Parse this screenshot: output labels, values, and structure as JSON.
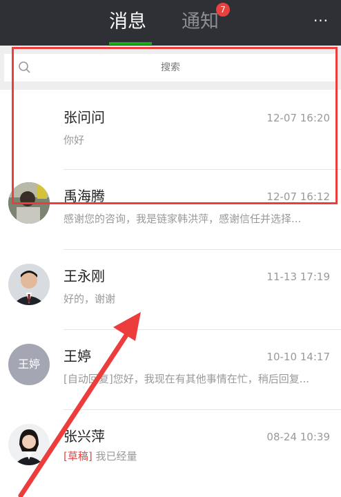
{
  "header": {
    "tabs": [
      {
        "label": "消息",
        "active": true
      },
      {
        "label": "通知",
        "active": false,
        "badge": "7"
      }
    ],
    "more_label": "···"
  },
  "search": {
    "placeholder": "搜索"
  },
  "conversations": [
    {
      "name": "张问问",
      "time": "12-07 16:20",
      "preview": "你好",
      "draft_tag": "",
      "avatar": "none"
    },
    {
      "name": "禹海腾",
      "time": "12-07 16:12",
      "preview": "感谢您的咨询，我是链家韩洪萍，感谢信任并选择...",
      "draft_tag": "",
      "avatar": "photo"
    },
    {
      "name": "王永刚",
      "time": "11-13 17:19",
      "preview": "好的，谢谢",
      "draft_tag": "",
      "avatar": "photo"
    },
    {
      "name": "王婷",
      "time": "10-10 14:17",
      "preview": "[自动回复]您好，我现在有其他事情在忙，稍后回复...",
      "draft_tag": "",
      "avatar": "text",
      "avatar_text": "王婷"
    },
    {
      "name": "张兴萍",
      "time": "08-24 10:39",
      "preview": "我已经量",
      "draft_tag": "[草稿]",
      "avatar": "photo"
    }
  ],
  "colors": {
    "header_bg": "#2e3035",
    "accent_green": "#1aad19",
    "badge_red": "#e64340",
    "annotation_red": "#ec3c3c"
  }
}
